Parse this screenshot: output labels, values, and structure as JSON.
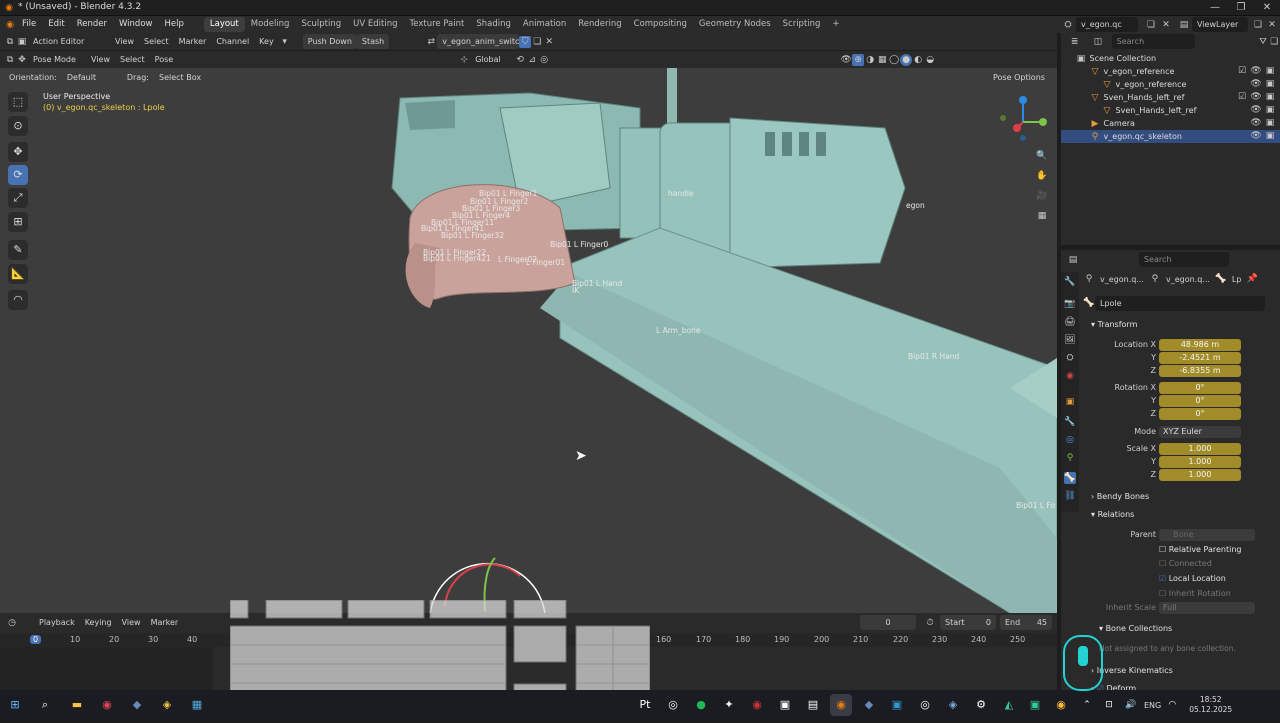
{
  "window": {
    "title": "* (Unsaved) - Blender 4.3.2",
    "controls": [
      "—",
      "❐",
      "✕"
    ]
  },
  "menubar": {
    "menus": [
      "File",
      "Edit",
      "Render",
      "Window",
      "Help"
    ],
    "workspaces": [
      "Layout",
      "Modeling",
      "Sculpting",
      "UV Editing",
      "Texture Paint",
      "Shading",
      "Animation",
      "Rendering",
      "Compositing",
      "Geometry Nodes",
      "Scripting"
    ],
    "active_workspace": "Layout",
    "add_tab": "+",
    "scene_name": "v_egon.qc",
    "view_layer": "ViewLayer"
  },
  "action_header": {
    "editor": "Action Editor",
    "menus": [
      "View",
      "Select",
      "Marker",
      "Channel",
      "Key"
    ],
    "push_down": "Push Down",
    "stash": "Stash",
    "action_name": "v_egon_anim_switch"
  },
  "viewport_header": {
    "mode": "Pose Mode",
    "menus": [
      "View",
      "Select",
      "Pose"
    ],
    "transform": "Global"
  },
  "viewport_subheader": {
    "orientation_label": "Orientation:",
    "orientation_value": "Default",
    "drag_label": "Drag:",
    "drag_value": "Select Box",
    "pose_options": "Pose Options"
  },
  "viewport": {
    "perspective": "User Perspective",
    "object_info": "(0) v_egon.qc_skeleton : Lpole",
    "bones": [
      "Bip01 L Finger1",
      "Bip01 L Finger2",
      "Bip01 L Finger3",
      "Bip01 L Finger4",
      "Bip01 L Finger11",
      "Bip01 L Finger41",
      "Bip01 L Finger32",
      "Bip01 L Finger0",
      "Bip01 L Finger22",
      "Bip01 L Finger421",
      "L Finger02",
      "L Finger01",
      "Bip01 L Hand",
      "IK",
      "handle",
      "egon",
      "L Arm_bone",
      "Bip01 R Hand",
      "Bip01 L Fo"
    ]
  },
  "outliner": {
    "search_placeholder": "Search",
    "root": "Scene Collection",
    "items": [
      {
        "label": "v_egon_reference",
        "indent": 1
      },
      {
        "label": "v_egon_reference",
        "indent": 2
      },
      {
        "label": "Sven_Hands_left_ref",
        "indent": 1
      },
      {
        "label": "Sven_Hands_left_ref",
        "indent": 2
      },
      {
        "label": "Camera",
        "indent": 1
      },
      {
        "label": "v_egon.qc_skeleton",
        "indent": 1
      }
    ]
  },
  "properties": {
    "search_placeholder": "Search",
    "breadcrumb": [
      "v_egon.q...",
      "v_egon.q...",
      "Lp"
    ],
    "bone_name": "Lpole",
    "transform_section": "Transform",
    "location": {
      "label_x": "Location X",
      "x": "48.986 m",
      "y": "-2.4521 m",
      "z": "-6.8355 m"
    },
    "rotation": {
      "label_x": "Rotation X",
      "x": "0°",
      "y": "0°",
      "z": "0°"
    },
    "axis_y": "Y",
    "axis_z": "Z",
    "mode_label": "Mode",
    "mode_value": "XYZ Euler",
    "scale": {
      "label_x": "Scale X",
      "x": "1.000",
      "y": "1.000",
      "z": "1.000"
    },
    "bendy_bones": "Bendy Bones",
    "relations": "Relations",
    "parent_label": "Parent",
    "parent_placeholder": "Bone",
    "relative_parenting": "Relative Parenting",
    "connected": "Connected",
    "local_location": "Local Location",
    "inherit_rotation": "Inherit Rotation",
    "inherit_scale_label": "Inherit Scale",
    "inherit_scale_value": "Full",
    "bone_collections": "Bone Collections",
    "bone_collections_note": "Not assigned to any bone collection.",
    "inverse_kinematics": "Inverse Kinematics",
    "deform": "Deform"
  },
  "timeline": {
    "menus": [
      "Playback",
      "Keying",
      "View",
      "Marker"
    ],
    "current_frame": "0",
    "start_label": "Start",
    "start_value": "0",
    "end_label": "End",
    "end_value": "45",
    "frames": [
      "0",
      "10",
      "20",
      "30",
      "40",
      "160",
      "170",
      "180",
      "190",
      "200",
      "210",
      "220",
      "230",
      "240",
      "250"
    ]
  },
  "taskbar": {
    "language": "ENG",
    "time": "18:52",
    "date": "05.12.2025"
  },
  "colors": {
    "accent": "#4772b3",
    "field_animated": "#a28c2a",
    "model_teal": "#94c3bb",
    "skin": "#c9a39b"
  }
}
